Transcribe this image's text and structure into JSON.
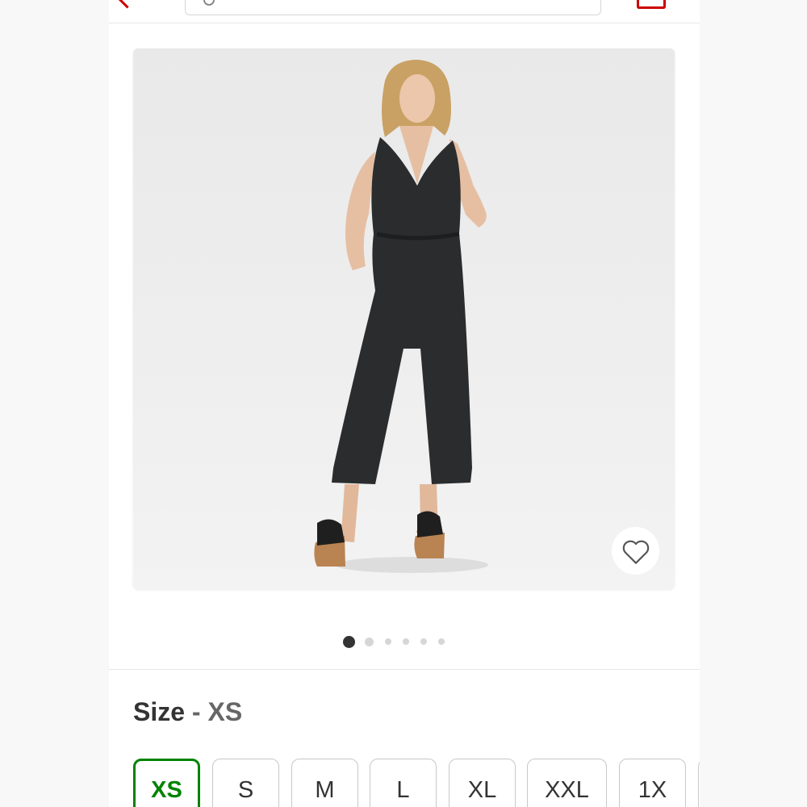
{
  "header": {
    "search": {
      "value": ""
    }
  },
  "product": {
    "image_alt": "Woman wearing a black sleeveless v-neck jumpsuit with cropped wide legs and platform sandals",
    "carousel": {
      "total_images": 6,
      "active_index": 0
    },
    "favorite": {
      "icon": "heart-outline-icon",
      "active": false
    }
  },
  "size_selector": {
    "label": "Size",
    "separator": "-",
    "selected": "XS",
    "options": [
      "XS",
      "S",
      "M",
      "L",
      "XL",
      "XXL",
      "1X"
    ]
  },
  "colors": {
    "accent": "#cc0000",
    "selected_chip": "#008300",
    "text": "#333333"
  }
}
